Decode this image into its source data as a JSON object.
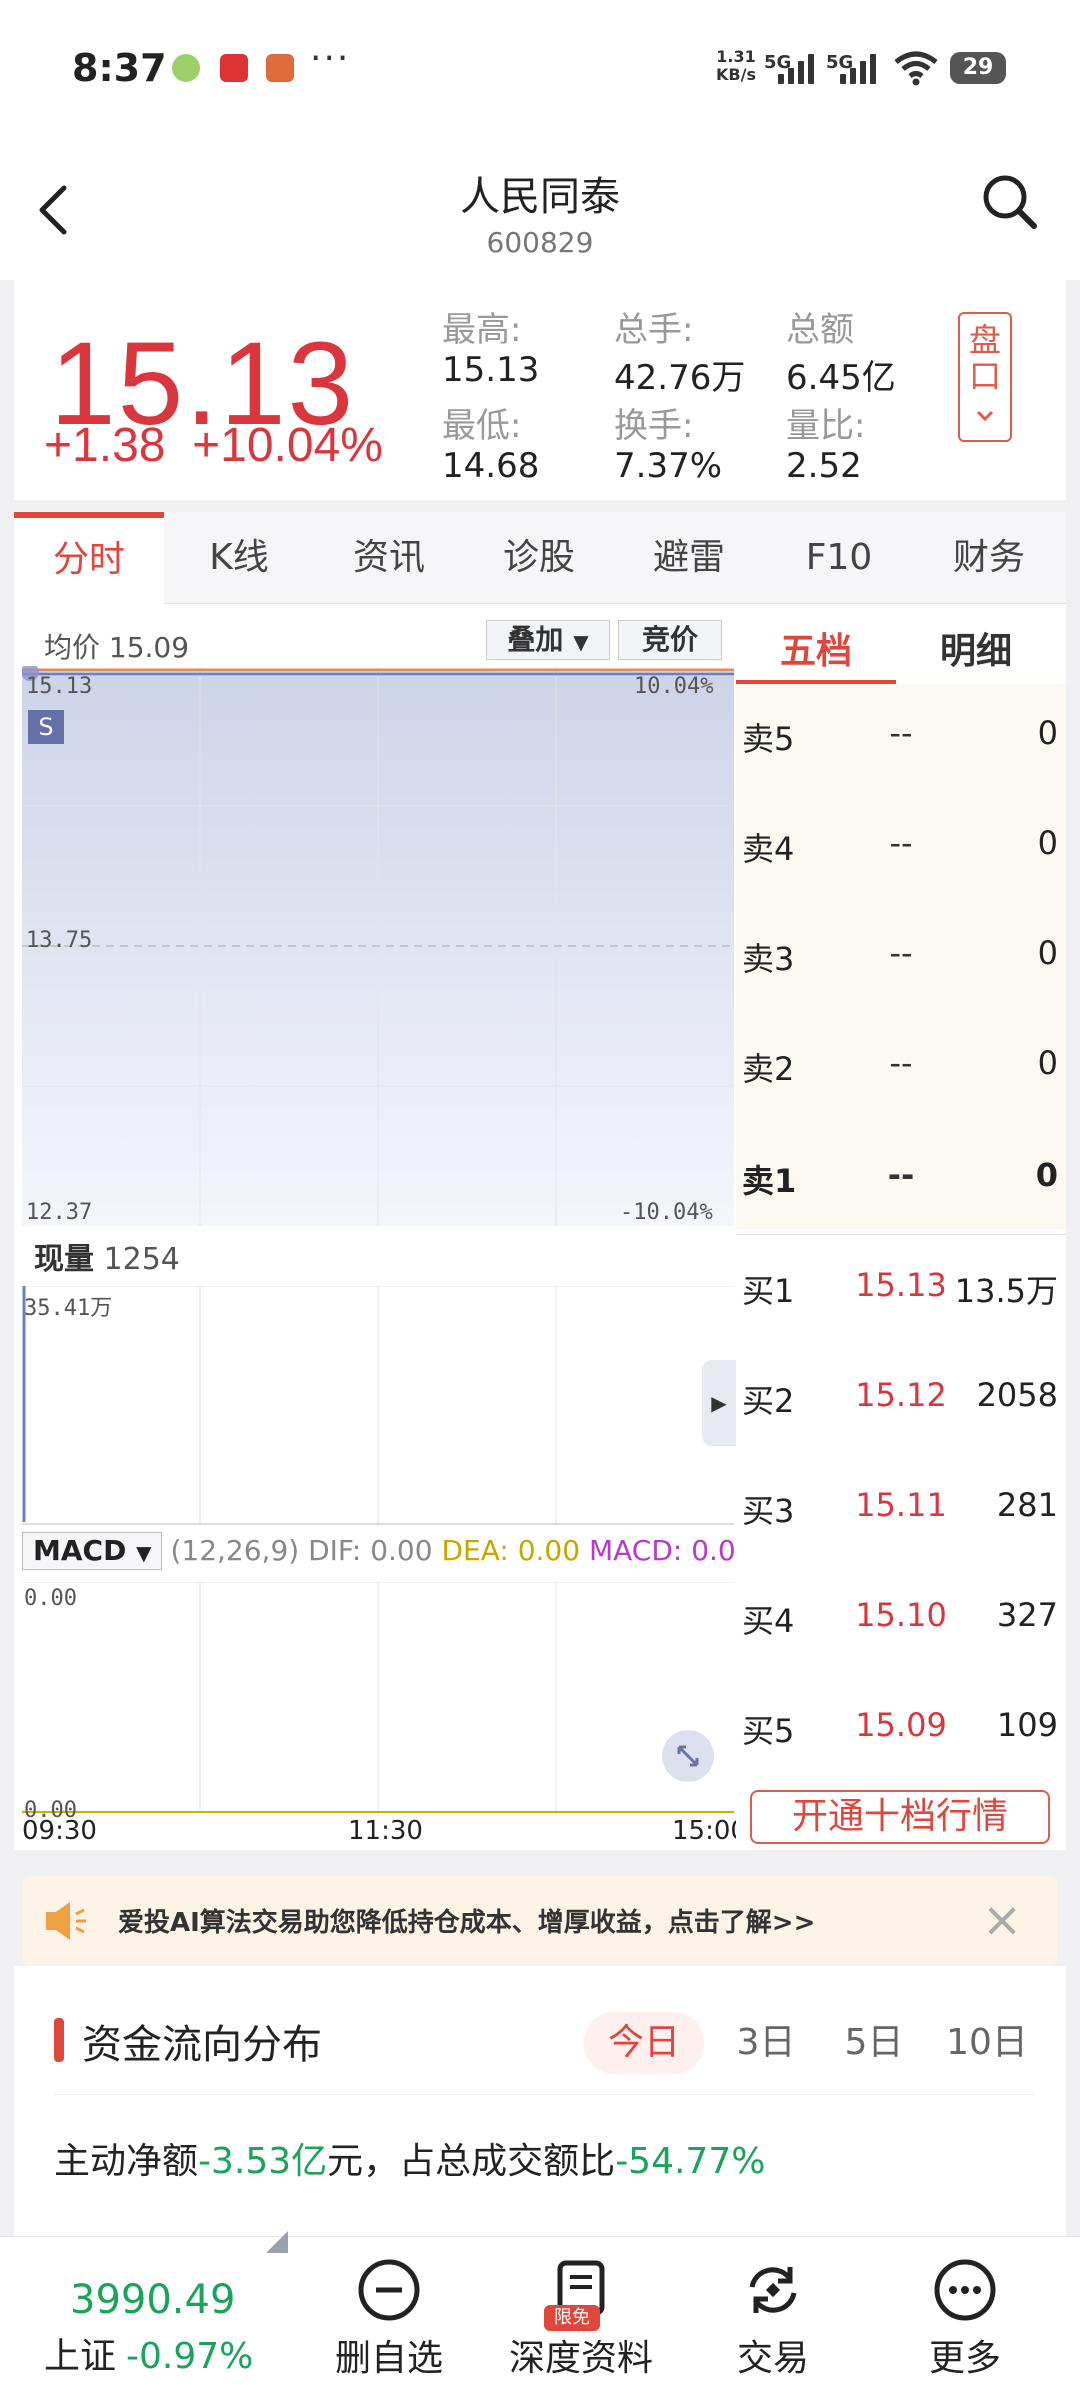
{
  "status_bar": {
    "time": "8:37",
    "net_speed_value": "1.31",
    "net_speed_unit": "KB/s",
    "sig1": "5G",
    "sig2": "5G",
    "battery": "29"
  },
  "header": {
    "title": "人民同泰",
    "code": "600829"
  },
  "quote": {
    "price": "15.13",
    "change": "+1.38",
    "change_pct": "+10.04%",
    "stats": [
      {
        "label": "最高:",
        "value": "15.13"
      },
      {
        "label": "总手:",
        "value": "42.76万"
      },
      {
        "label": "总额",
        "value": "6.45亿"
      },
      {
        "label": "最低:",
        "value": "14.68"
      },
      {
        "label": "换手:",
        "value": "7.37%"
      },
      {
        "label": "量比:",
        "value": "2.52"
      }
    ],
    "pankou_label": "盘口"
  },
  "tabs": [
    "分时",
    "K线",
    "资讯",
    "诊股",
    "避雷",
    "F10",
    "财务"
  ],
  "chart": {
    "avg_label": "均价 15.09",
    "overlay_btn": "叠加",
    "auction_btn": "竞价",
    "marker": "S",
    "price_high": "15.13",
    "price_mid": "13.75",
    "price_low": "12.37",
    "pct_high": "10.04%",
    "pct_low": "-10.04%",
    "volume_label": "现量",
    "volume_value": "1254",
    "volume_max": "35.41万",
    "macd_selector": "MACD",
    "macd_params": "(12,26,9)",
    "dif": "DIF: 0.00",
    "dea": "DEA: 0.00",
    "macd": "MACD: 0.0",
    "macd_top": "0.00",
    "macd_bottom": "0.00",
    "time_start": "09:30",
    "time_mid": "11:30",
    "time_end": "15:00",
    "colors": {
      "up": "#d9363e",
      "price_line": "#e98a55",
      "avg_line": "#6a7fc4",
      "fill": "#cdd4e8"
    }
  },
  "order_book": {
    "tabs": [
      "五档",
      "明细"
    ],
    "sells": [
      {
        "name": "卖5",
        "price": "--",
        "qty": "0"
      },
      {
        "name": "卖4",
        "price": "--",
        "qty": "0"
      },
      {
        "name": "卖3",
        "price": "--",
        "qty": "0"
      },
      {
        "name": "卖2",
        "price": "--",
        "qty": "0"
      },
      {
        "name": "卖1",
        "price": "--",
        "qty": "0"
      }
    ],
    "buys": [
      {
        "name": "买1",
        "price": "15.13",
        "qty": "13.5万"
      },
      {
        "name": "买2",
        "price": "15.12",
        "qty": "2058"
      },
      {
        "name": "买3",
        "price": "15.11",
        "qty": "281"
      },
      {
        "name": "买4",
        "price": "15.10",
        "qty": "327"
      },
      {
        "name": "买5",
        "price": "15.09",
        "qty": "109"
      }
    ],
    "open_ten_btn": "开通十档行情"
  },
  "banner": {
    "text": "爱投AI算法交易助您降低持仓成本、增厚收益，点击了解>>"
  },
  "fund_flow": {
    "title": "资金流向分布",
    "periods": [
      "今日",
      "3日",
      "5日",
      "10日"
    ],
    "stat_prefix": "主动净额",
    "stat_value": "-3.53亿",
    "stat_mid": "元，占总成交额比",
    "stat_pct": "-54.77%"
  },
  "bottom_nav": {
    "index_value": "3990.49",
    "index_name": "上证",
    "index_change": "-0.97%",
    "items": [
      "删自选",
      "深度资料",
      "交易",
      "更多"
    ],
    "badge": "限免"
  }
}
